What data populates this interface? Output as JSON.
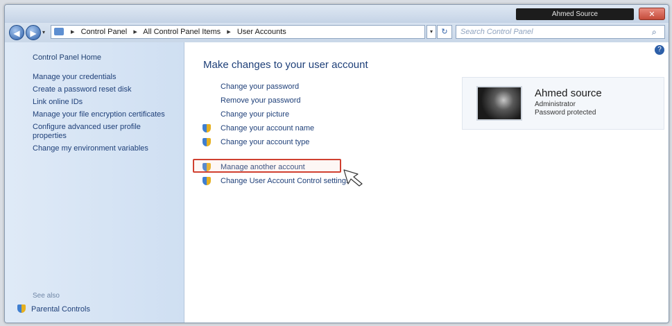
{
  "window": {
    "title": "Ahmed Source",
    "close_label": "✕"
  },
  "address": {
    "crumbs": [
      "Control Panel",
      "All Control Panel Items",
      "User Accounts"
    ],
    "search_placeholder": "Search Control Panel",
    "refresh_glyph": "↻",
    "dropdown_glyph": "▾"
  },
  "sidebar": {
    "home": "Control Panel Home",
    "links": [
      "Manage your credentials",
      "Create a password reset disk",
      "Link online IDs",
      "Manage your file encryption certificates",
      "Configure advanced user profile properties",
      "Change my environment variables"
    ],
    "see_also": "See also",
    "parental": "Parental Controls"
  },
  "main": {
    "title": "Make changes to your user account",
    "tasks": [
      {
        "label": "Change your password",
        "shield": false
      },
      {
        "label": "Remove your password",
        "shield": false
      },
      {
        "label": "Change your picture",
        "shield": false
      },
      {
        "label": "Change your account name",
        "shield": true
      },
      {
        "label": "Change your account type",
        "shield": true
      }
    ],
    "tasks2": [
      {
        "label": "Manage another account",
        "shield": true,
        "highlighted": true
      },
      {
        "label": "Change User Account Control settings",
        "shield": true
      }
    ]
  },
  "account": {
    "name": "Ahmed source",
    "role": "Administrator",
    "password_state": "Password protected"
  },
  "colors": {
    "link": "#1e3f78",
    "highlight_border": "#d04030"
  },
  "icons": {
    "back": "back-arrow-icon",
    "forward": "forward-arrow-icon",
    "search": "search-icon",
    "help": "help-icon",
    "uac": "uac-shield-icon",
    "cursor": "pointer-cursor-icon"
  }
}
